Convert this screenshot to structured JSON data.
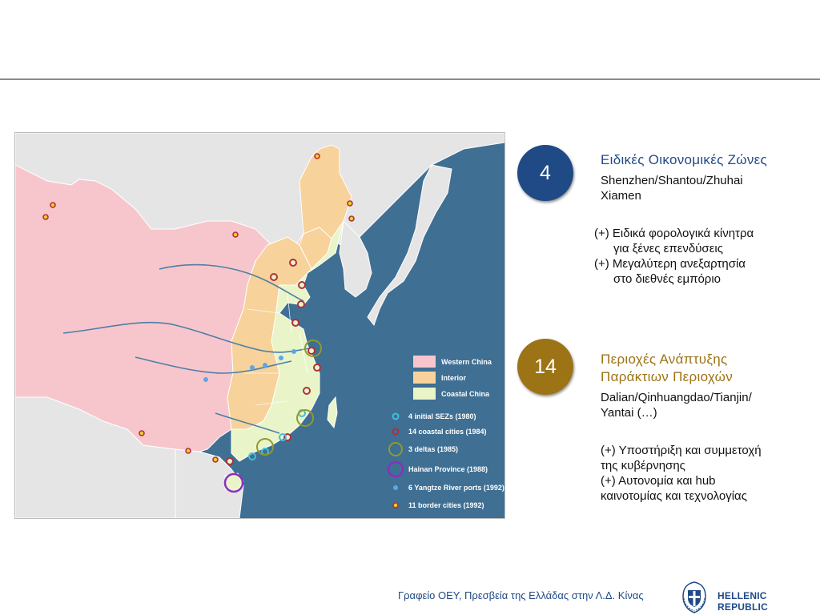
{
  "sez": {
    "count": "4",
    "title": "Ειδικές Οικονομικές Ζώνες",
    "line1": "Shenzhen/Shantou/Zhuhai",
    "line2": "Xiamen",
    "benefit1_a": "(+) Ειδικά φορολογικά κίνητρα",
    "benefit1_b": "για ξένες επενδύσεις",
    "benefit2_a": "(+) Μεγαλύτερη ανεξαρτησία",
    "benefit2_b": "στο διεθνές εμπόριο"
  },
  "coastal": {
    "count": "14",
    "title1": "Περιοχές Ανάπτυξης",
    "title2": "Παράκτιων Περιοχών",
    "line1": "Dalian/Qinhuangdao/Tianjin/",
    "line2": "Yantai (…)",
    "benefit1": "(+) Υποστήριξη και συμμετοχή",
    "benefit2": "της κυβέρνησης",
    "benefit3": "(+) Αυτονομία και hub",
    "benefit4": "καινοτομίας και τεχνολογίας"
  },
  "map": {
    "legend_regions": [
      {
        "label": "Western China",
        "color": "#f7c6cc"
      },
      {
        "label": "Interior",
        "color": "#f7d29a"
      },
      {
        "label": "Coastal China",
        "color": "#e9f5c8"
      }
    ],
    "legend_markers": [
      {
        "label": "4 initial SEZs (1980)",
        "marker": "cyan-ring"
      },
      {
        "label": "14 coastal cities (1984)",
        "marker": "red-ring"
      },
      {
        "label": "3 deltas (1985)",
        "marker": "olive-ring"
      },
      {
        "label": "Hainan Province (1988)",
        "marker": "purple-ring"
      },
      {
        "label": "6 Yangtze River ports (1992)",
        "marker": "blue-dot"
      },
      {
        "label": "11 border cities (1992)",
        "marker": "yellow-dot"
      }
    ],
    "colors": {
      "sea": "#3f6f93",
      "neighbors": "#e5e5e5",
      "western": "#f7c6cc",
      "interior": "#f7d29a",
      "coastal": "#e9f5c8",
      "rivers": "#4d7fa6",
      "seza": "#3fc0dc",
      "coastal_city": "#b0303c",
      "delta": "#8f9b2a",
      "hainan": "#8a2fc2",
      "border_city_fill": "#f5d020",
      "border_city_stroke": "#b0303c"
    }
  },
  "footer": {
    "office": "Γραφείο ΟΕΥ, Πρεσβεία της Ελλάδας στην Λ.Δ. Κίνας",
    "republic": "HELLENIC REPUBLIC"
  }
}
